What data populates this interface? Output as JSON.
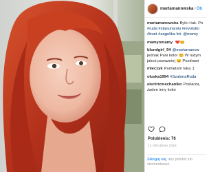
{
  "header": {
    "username": "martamanowska",
    "separator": "•",
    "follow_label": "Ob"
  },
  "caption": {
    "username": "martamanowska",
    "text1": "Było i tak. Po",
    "line2": "#ruda #stanumysłu #revolutio",
    "line3": "#bunt #angelika fot. @mamy"
  },
  "comments": [
    {
      "user": "mamyomamy",
      "text": ""
    },
    {
      "user": "blondgirl_94",
      "text": "@martamanow"
    },
    {
      "user": "",
      "text": "jednak Pani kolor 😊 W rudym"
    },
    {
      "user": "",
      "text": "jakoś poważniej 😊 Pozdrawi"
    },
    {
      "user": "mleczyk",
      "text": "Pamiętam taką :)"
    },
    {
      "user": "oluska1994",
      "text": "#SzalonaRuda"
    },
    {
      "user": "electricmechaniko",
      "text": "Postarza,"
    },
    {
      "user": "",
      "text": "żaden inny kolor"
    }
  ],
  "likes": "Polubienia: 76",
  "date": "12 GRUDNIA 2018",
  "login": {
    "link": "Zaloguj się",
    "text": ", aby polubić lub skomentować."
  },
  "icons": {
    "like": "heart-icon",
    "comment": "comment-icon"
  },
  "colors": {
    "link": "#3897f0",
    "hair": "#b5321c"
  }
}
